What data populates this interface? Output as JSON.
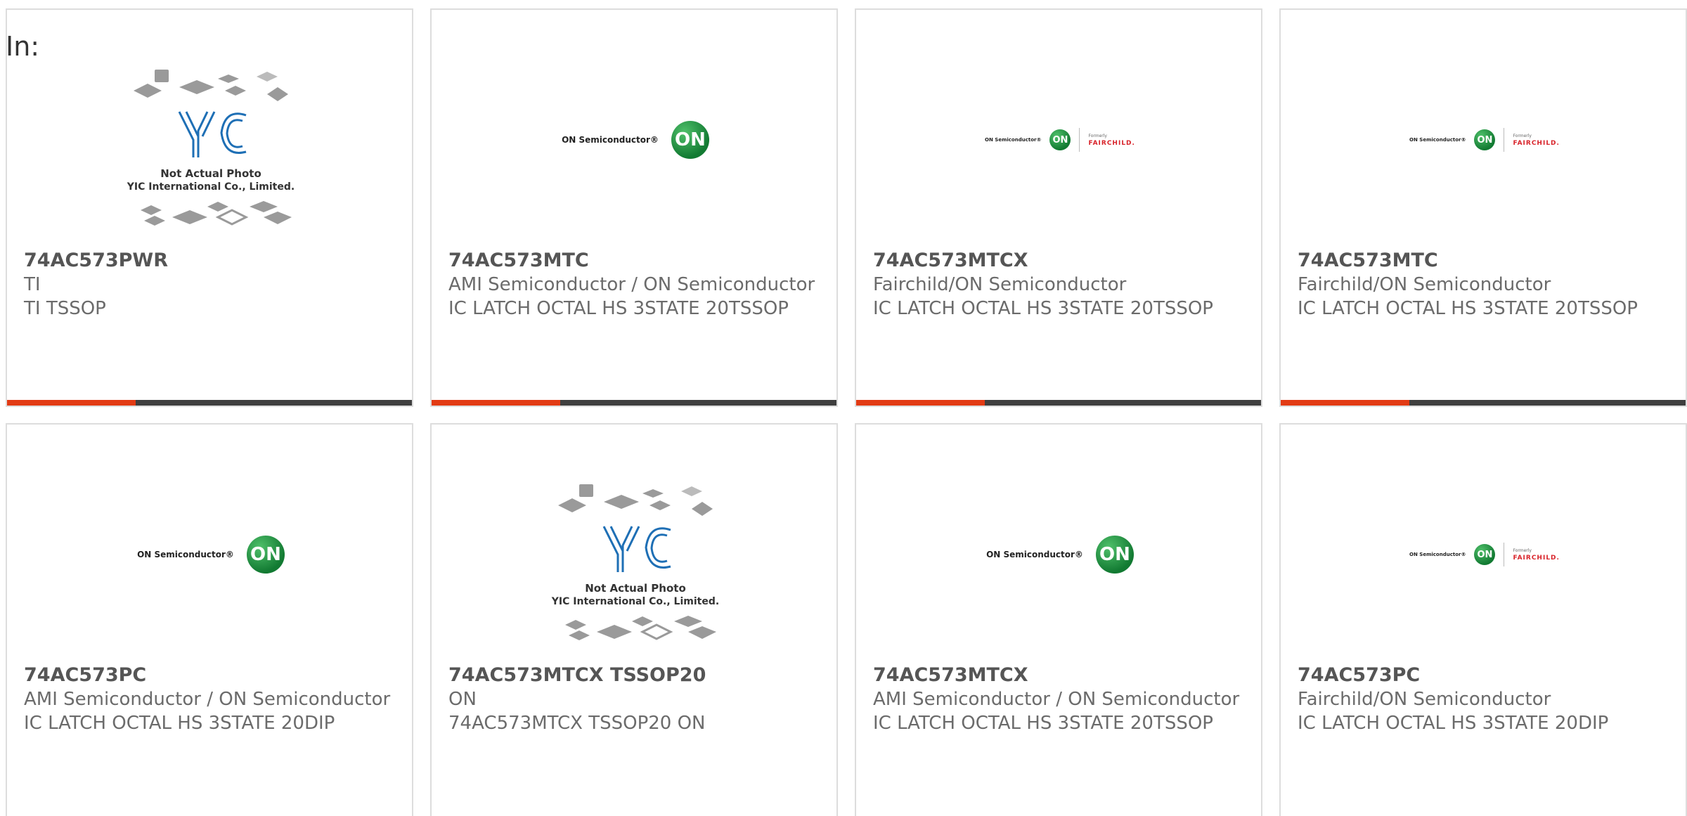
{
  "filter": {
    "label": "In:"
  },
  "logos": {
    "on_text": "ON Semiconductor®",
    "on_mark": "ON",
    "formerly": "Formerly",
    "fairchild": "FAIRCHILD."
  },
  "yic": {
    "not_actual": "Not Actual Photo",
    "company": "YIC International Co., Limited."
  },
  "products": [
    {
      "part": "74AC573PWR",
      "maker": "TI",
      "desc": "TI TSSOP",
      "logo": "yic"
    },
    {
      "part": "74AC573MTC",
      "maker": "AMI Semiconductor / ON Semiconductor",
      "desc": "IC LATCH OCTAL HS 3STATE 20TSSOP",
      "logo": "on"
    },
    {
      "part": "74AC573MTCX",
      "maker": "Fairchild/ON Semiconductor",
      "desc": "IC LATCH OCTAL HS 3STATE 20TSSOP",
      "logo": "on-fairchild"
    },
    {
      "part": "74AC573MTC",
      "maker": "Fairchild/ON Semiconductor",
      "desc": "IC LATCH OCTAL HS 3STATE 20TSSOP",
      "logo": "on-fairchild"
    },
    {
      "part": "74AC573PC",
      "maker": "AMI Semiconductor / ON Semiconductor",
      "desc": "IC LATCH OCTAL HS 3STATE 20DIP",
      "logo": "on"
    },
    {
      "part": "74AC573MTCX TSSOP20",
      "maker": "ON",
      "desc": "74AC573MTCX TSSOP20 ON",
      "logo": "yic"
    },
    {
      "part": "74AC573MTCX",
      "maker": "AMI Semiconductor / ON Semiconductor",
      "desc": "IC LATCH OCTAL HS 3STATE 20TSSOP",
      "logo": "on"
    },
    {
      "part": "74AC573PC",
      "maker": "Fairchild/ON Semiconductor",
      "desc": "IC LATCH OCTAL HS 3STATE 20DIP",
      "logo": "on-fairchild"
    }
  ],
  "colors": {
    "accent": "#e23b14",
    "bar": "#3f3f3f",
    "on_green": "#1f9a45",
    "yic_blue": "#1e6fb5"
  }
}
